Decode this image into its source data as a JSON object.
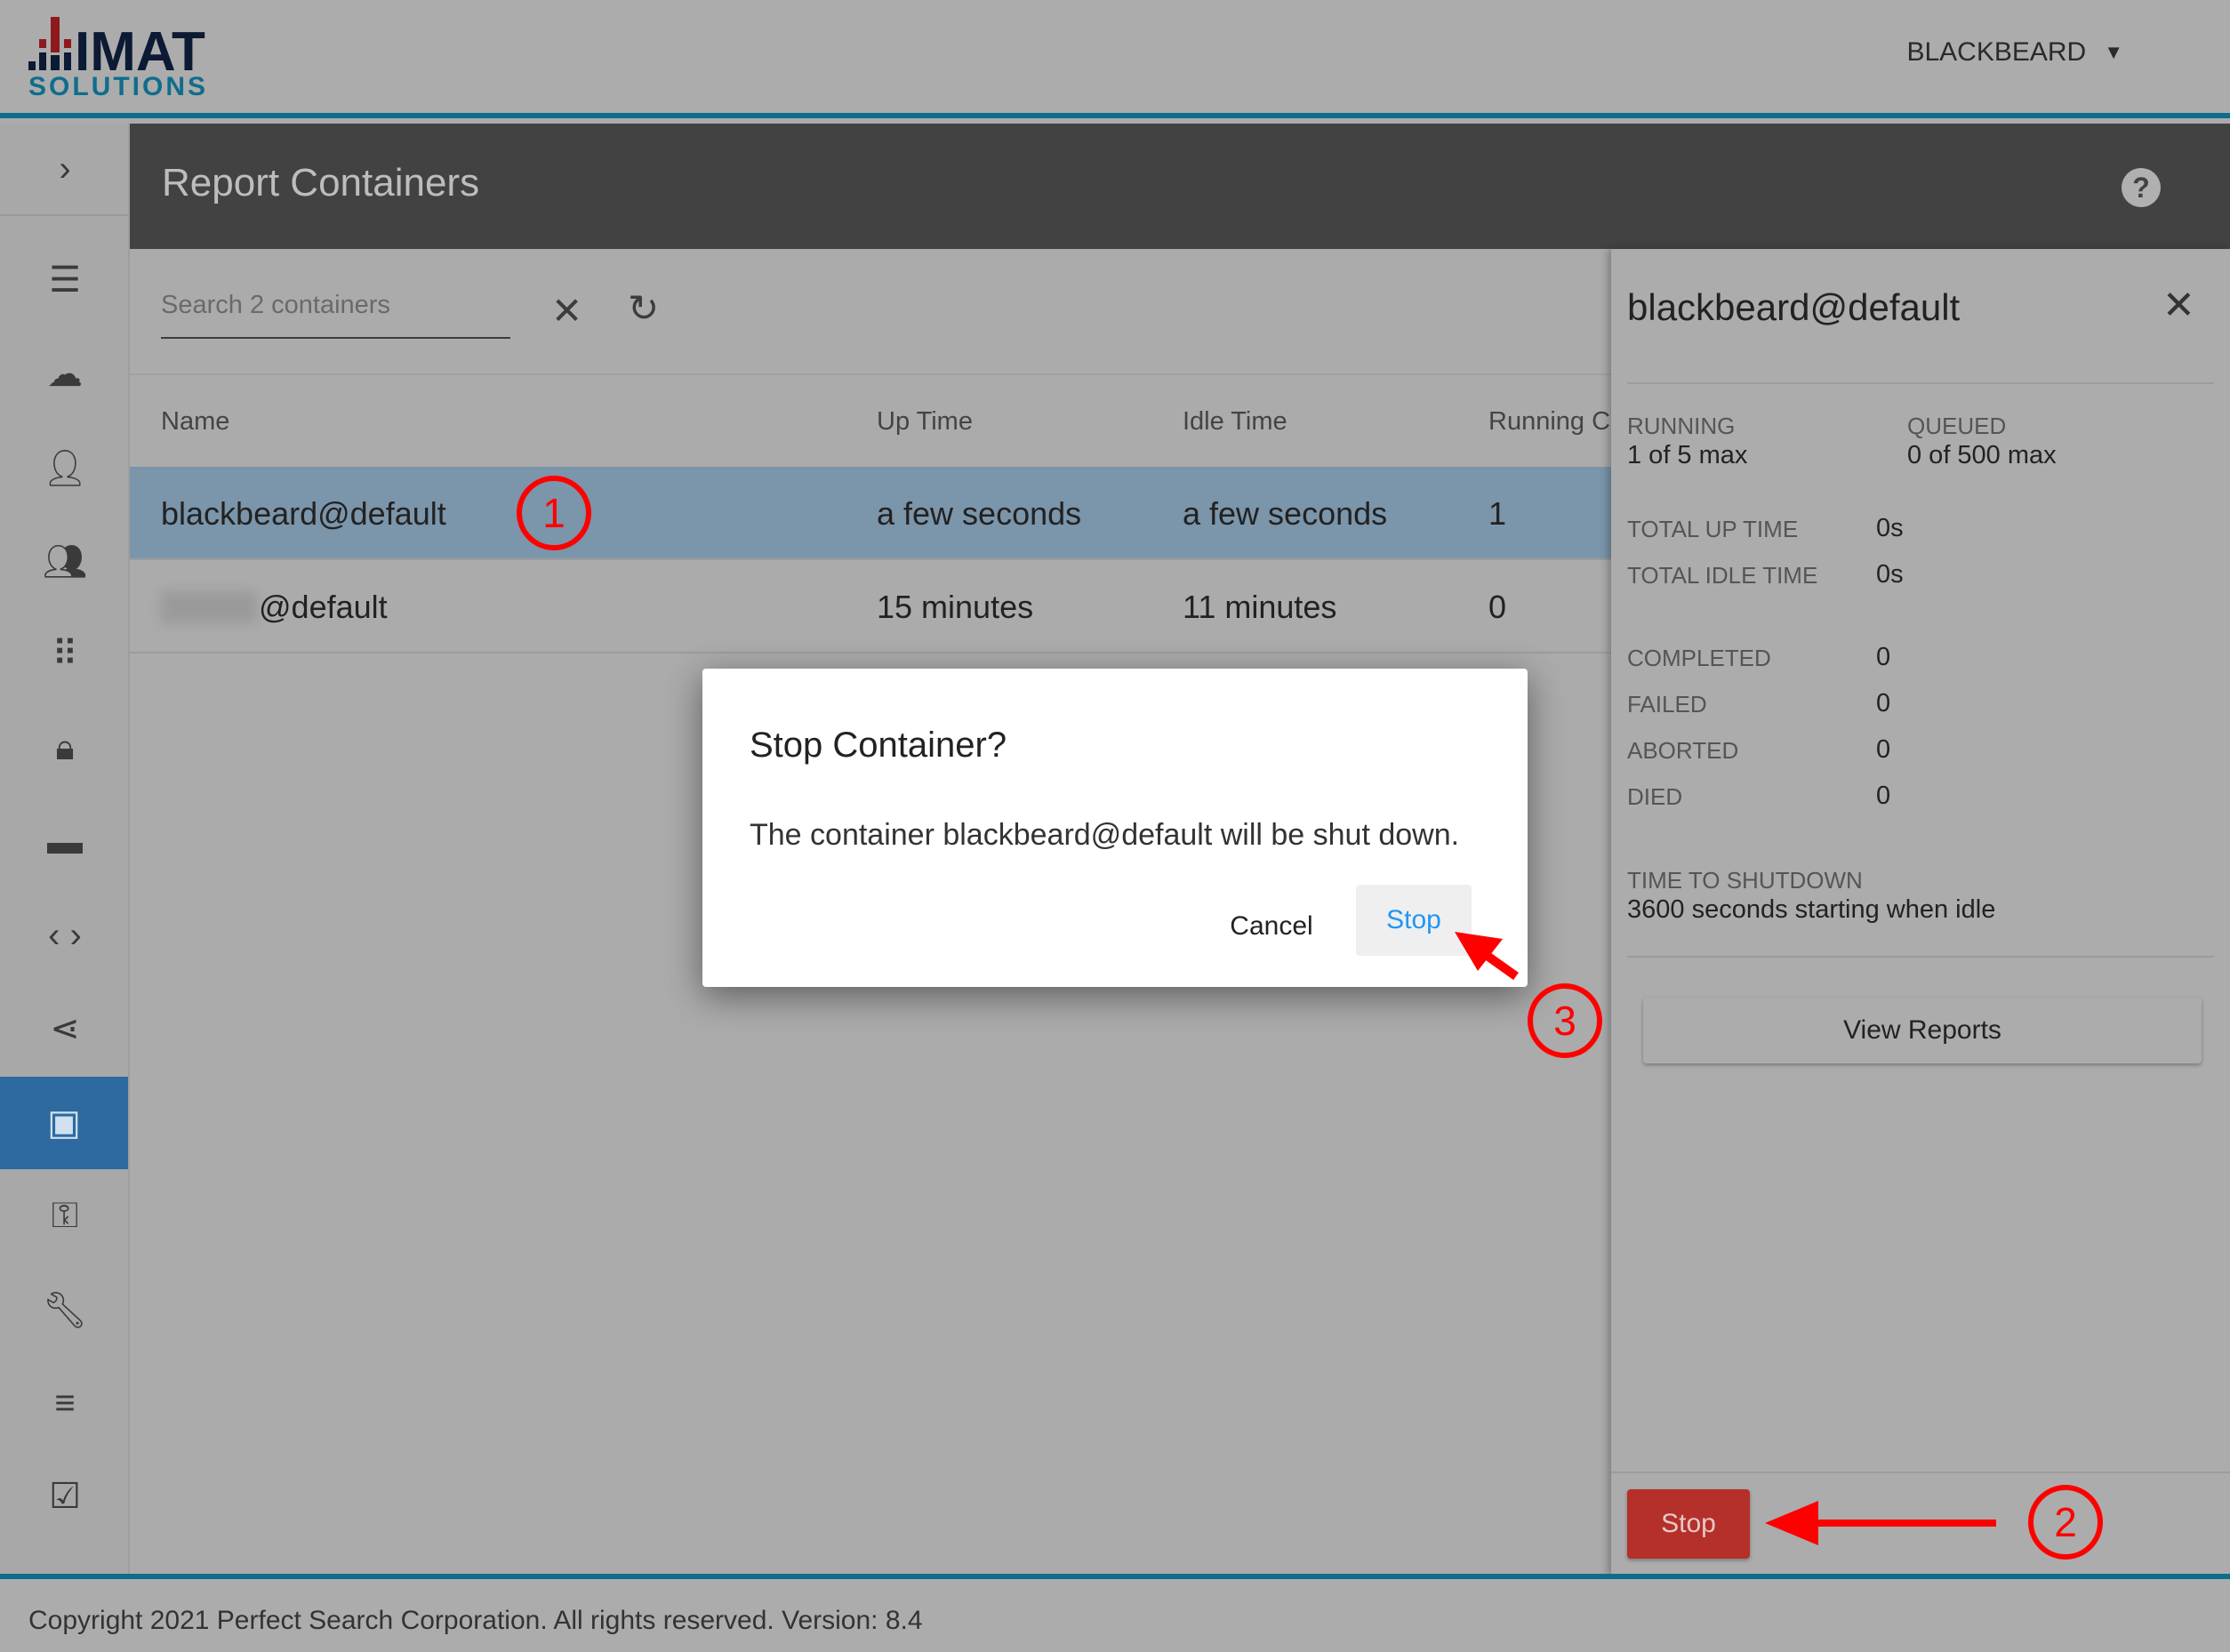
{
  "header": {
    "logo_text": "IMAT",
    "logo_subtext": "SOLUTIONS",
    "user": "BLACKBEARD"
  },
  "page": {
    "title": "Report Containers"
  },
  "toolbar": {
    "search_placeholder": "Search 2 containers"
  },
  "table": {
    "columns": [
      "Name",
      "Up Time",
      "Idle Time",
      "Running C"
    ],
    "rows": [
      {
        "name": "blackbeard@default",
        "up": "a few seconds",
        "idle": "a few seconds",
        "running": "1",
        "selected": true
      },
      {
        "name": "@default",
        "up": "15 minutes",
        "idle": "11 minutes",
        "running": "0",
        "selected": false
      }
    ]
  },
  "panel": {
    "title": "blackbeard@default",
    "running_label": "RUNNING",
    "running_value": "1 of 5 max",
    "queued_label": "QUEUED",
    "queued_value": "0 of 500 max",
    "stats": [
      {
        "label": "TOTAL UP TIME",
        "value": "0s"
      },
      {
        "label": "TOTAL IDLE TIME",
        "value": "0s"
      },
      {
        "label": "COMPLETED",
        "value": "0"
      },
      {
        "label": "FAILED",
        "value": "0"
      },
      {
        "label": "ABORTED",
        "value": "0"
      },
      {
        "label": "DIED",
        "value": "0"
      }
    ],
    "shutdown_label": "TIME TO SHUTDOWN",
    "shutdown_value": "3600 seconds starting when idle",
    "view_reports": "View Reports",
    "stop": "Stop"
  },
  "dialog": {
    "title": "Stop Container?",
    "body": "The container blackbeard@default will be shut down.",
    "cancel": "Cancel",
    "confirm": "Stop"
  },
  "annotations": [
    "1",
    "2",
    "3"
  ],
  "footer": {
    "text": "Copyright 2021 Perfect Search Corporation. All rights reserved. Version: 8.4"
  },
  "colors": {
    "accent": "#0f6d8c",
    "selected_nav": "#2c6aa0",
    "stop_button": "#b5302b",
    "annotation": "#ff0000",
    "dialog_link": "#2196f3"
  }
}
